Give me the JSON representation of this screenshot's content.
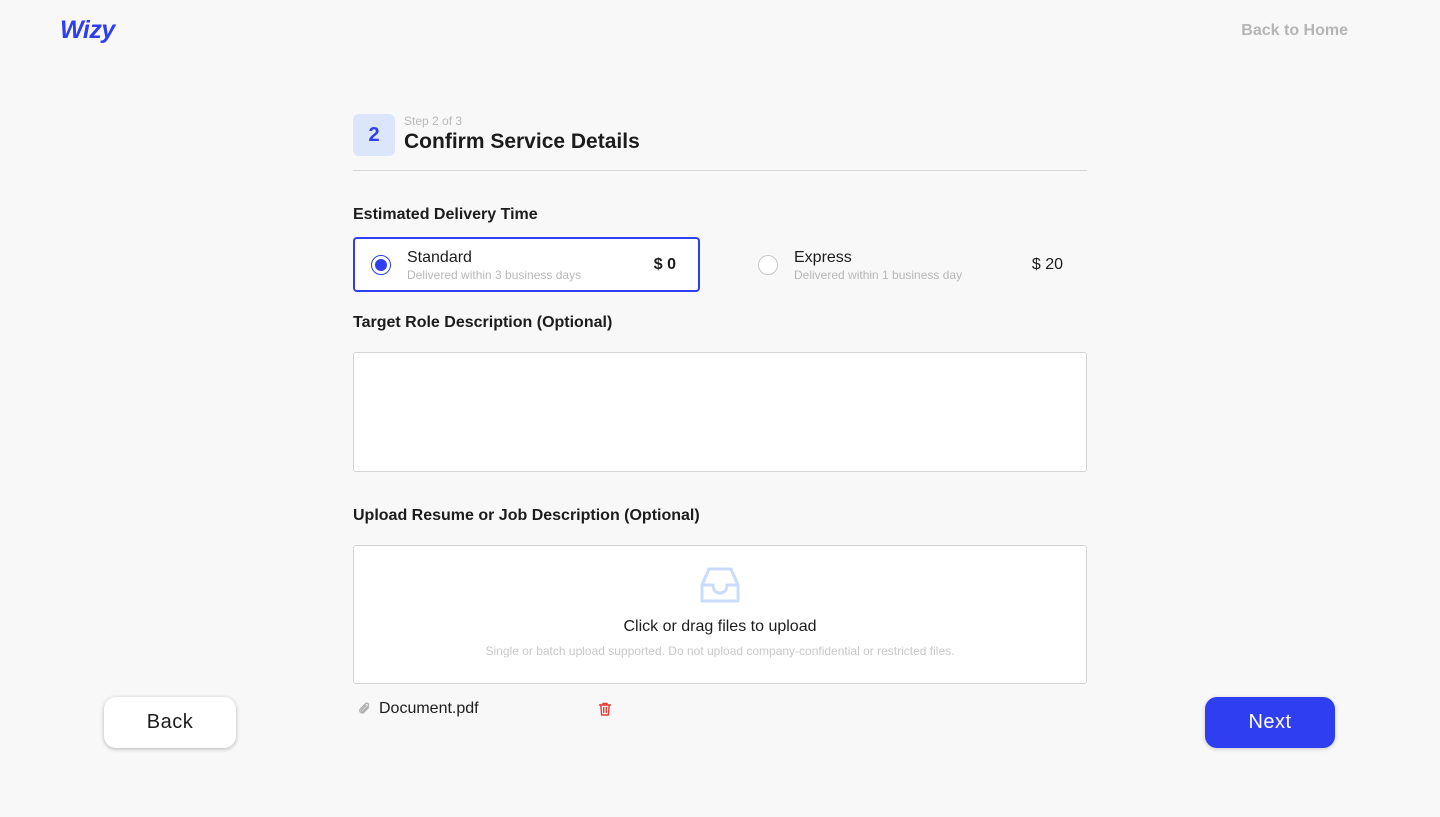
{
  "header": {
    "logo": "Wizy",
    "back_home": "Back to Home"
  },
  "step": {
    "number": "2",
    "count": "Step 2 of 3",
    "title": "Confirm Service Details"
  },
  "delivery": {
    "label": "Estimated Delivery Time",
    "options": [
      {
        "name": "Standard",
        "sub": "Delivered within 3 business days",
        "price": "$ 0",
        "selected": true
      },
      {
        "name": "Express",
        "sub": "Delivered within 1 business day",
        "price": "$ 20",
        "selected": false
      }
    ]
  },
  "role": {
    "label": "Target Role Description (Optional)",
    "value": ""
  },
  "upload": {
    "label": "Upload Resume or Job Description (Optional)",
    "main": "Click or drag files to upload",
    "sub": "Single or batch upload supported. Do not upload company-confidential or restricted files.",
    "file_name": "Document.pdf"
  },
  "actions": {
    "back": "Back",
    "next": "Next"
  },
  "colors": {
    "accent": "#2e3ef0",
    "badge_bg": "#dbe6fb",
    "delete": "#e53935",
    "upload_icon": "#c9dcfb"
  }
}
